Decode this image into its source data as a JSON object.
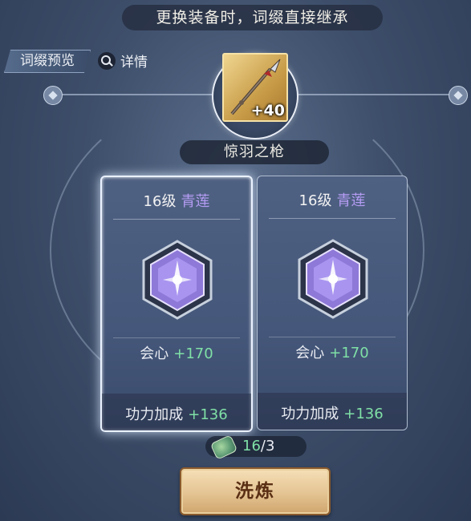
{
  "header": {
    "banner": "更换装备时，词缀直接继承",
    "preview_tab": "词缀预览",
    "detail_label": "详情"
  },
  "weapon": {
    "enhance": "+40",
    "name": "惊羽之枪"
  },
  "cards": [
    {
      "level": "16级",
      "quality": "青莲",
      "stat1_name": "会心",
      "stat1_value": "+170",
      "stat2_name": "功力加成",
      "stat2_value": "+136"
    },
    {
      "level": "16级",
      "quality": "青莲",
      "stat1_name": "会心",
      "stat1_value": "+170",
      "stat2_name": "功力加成",
      "stat2_value": "+136"
    }
  ],
  "counter": {
    "current": "16",
    "required": "/3"
  },
  "action": {
    "wash_label": "洗炼"
  },
  "colors": {
    "quality": "#b49cf3",
    "stat_value": "#7fe0a6"
  }
}
